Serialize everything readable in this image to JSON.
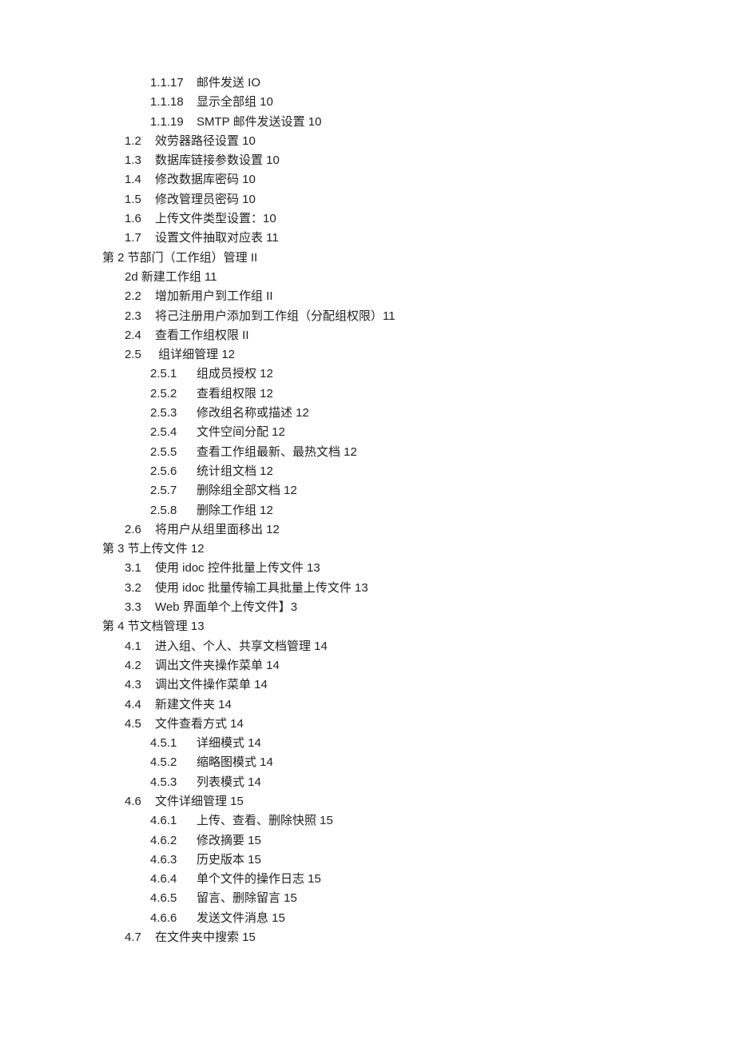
{
  "toc": [
    {
      "level": 3,
      "num": "1.1.17",
      "text": "邮件发送 IO"
    },
    {
      "level": 3,
      "num": "1.1.18",
      "text": "显示全部组 10"
    },
    {
      "level": 3,
      "num": "1.1.19",
      "text": "SMTP 邮件发送设置 10"
    },
    {
      "level": 2,
      "num": "1.2",
      "text": "效劳器路径设置 10"
    },
    {
      "level": 2,
      "num": "1.3",
      "text": "数据库链接参数设置 10"
    },
    {
      "level": 2,
      "num": "1.4",
      "text": "修改数据库密码 10"
    },
    {
      "level": 2,
      "num": "1.5",
      "text": "修改管理员密码 10"
    },
    {
      "level": 2,
      "num": "1.6",
      "text": "上传文件类型设置：10"
    },
    {
      "level": 2,
      "num": "1.7",
      "text": "设置文件抽取对应表 11"
    },
    {
      "level": 1,
      "num": "",
      "text": "第 2 节部门（工作组）管理 II"
    },
    {
      "level": 2,
      "num": "",
      "text": "2d 新建工作组 11"
    },
    {
      "level": 2,
      "num": "2.2",
      "text": "增加新用户到工作组 II"
    },
    {
      "level": 2,
      "num": "2.3",
      "text": "将己注册用户添加到工作组（分配组权限）11"
    },
    {
      "level": 2,
      "num": "2.4",
      "text": "查看工作组权限 II"
    },
    {
      "level": 2,
      "num": "2.5",
      "text": " 组详细管理 12"
    },
    {
      "level": 3,
      "num": "2.5.1",
      "text": "组成员授权 12"
    },
    {
      "level": 3,
      "num": "2.5.2",
      "text": "查看组权限 12"
    },
    {
      "level": 3,
      "num": "2.5.3",
      "text": "修改组名称或描述 12"
    },
    {
      "level": 3,
      "num": "2.5.4",
      "text": "文件空间分配 12"
    },
    {
      "level": 3,
      "num": "2.5.5",
      "text": "查看工作组最新、最热文档 12"
    },
    {
      "level": 3,
      "num": "2.5.6",
      "text": "统计组文档 12"
    },
    {
      "level": 3,
      "num": "2.5.7",
      "text": "删除组全部文档 12"
    },
    {
      "level": 3,
      "num": "2.5.8",
      "text": "删除工作组 12"
    },
    {
      "level": 2,
      "num": "2.6",
      "text": "将用户从组里面移出 12"
    },
    {
      "level": 1,
      "num": "",
      "text": "第 3 节上传文件 12"
    },
    {
      "level": 2,
      "num": "3.1",
      "text": "使用 idoc 控件批量上传文件 13"
    },
    {
      "level": 2,
      "num": "3.2",
      "text": "使用 idoc 批量传输工具批量上传文件 13"
    },
    {
      "level": 2,
      "num": "3.3",
      "text": "Web 界面单个上传文件】3"
    },
    {
      "level": 1,
      "num": "",
      "text": "第 4 节文档管理 13"
    },
    {
      "level": 2,
      "num": "4.1",
      "text": "进入组、个人、共享文档管理 14"
    },
    {
      "level": 2,
      "num": "4.2",
      "text": "调出文件夹操作菜单 14"
    },
    {
      "level": 2,
      "num": "4.3",
      "text": "调出文件操作菜单 14"
    },
    {
      "level": 2,
      "num": "4.4",
      "text": "新建文件夹 14"
    },
    {
      "level": 2,
      "num": "4.5",
      "text": "文件查看方式 14"
    },
    {
      "level": 3,
      "num": "4.5.1",
      "text": "详细模式 14"
    },
    {
      "level": 3,
      "num": "4.5.2",
      "text": "缩略图模式 14"
    },
    {
      "level": 3,
      "num": "4.5.3",
      "text": "列表模式 14"
    },
    {
      "level": 2,
      "num": "4.6",
      "text": "文件详细管理 15"
    },
    {
      "level": 3,
      "num": "4.6.1",
      "text": "上传、查看、删除快照 15"
    },
    {
      "level": 3,
      "num": "4.6.2",
      "text": "修改摘要 15"
    },
    {
      "level": 3,
      "num": "4.6.3",
      "text": "历史版本 15"
    },
    {
      "level": 3,
      "num": "4.6.4",
      "text": "单个文件的操作日志 15"
    },
    {
      "level": 3,
      "num": "4.6.5",
      "text": "留言、删除留言 15"
    },
    {
      "level": 3,
      "num": "4.6.6",
      "text": "发送文件消息 15"
    },
    {
      "level": 2,
      "num": "4.7",
      "text": "在文件夹中搜索 15"
    }
  ]
}
